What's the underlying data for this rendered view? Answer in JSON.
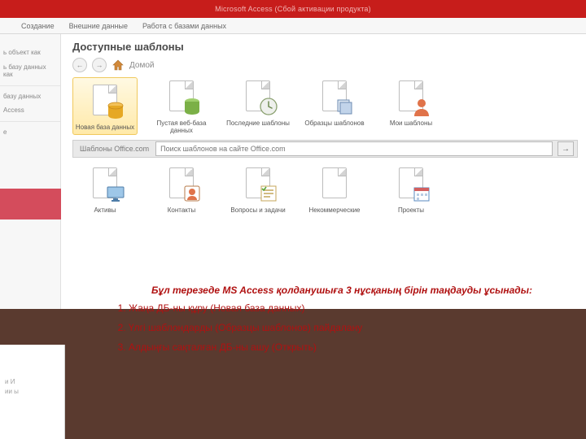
{
  "titlebar": "Microsoft Access (Сбой активации продукта)",
  "ribbon_tabs": [
    "",
    "Создание",
    "Внешние данные",
    "Работа с базами данных"
  ],
  "left_panel": {
    "items_top": [
      "",
      "ь объект как",
      "ь базу данных как"
    ],
    "items_mid": [
      "базу данных",
      "Access"
    ],
    "е": "е",
    "footer": [
      "и И",
      "ии\nы"
    ]
  },
  "main": {
    "section_title": "Доступные шаблоны",
    "crumb": "Домой",
    "templates_row1": [
      {
        "label": "Новая база данных",
        "icon": "db-yellow",
        "selected": true
      },
      {
        "label": "Пустая веб-база данных",
        "icon": "db-green"
      },
      {
        "label": "Последние шаблоны",
        "icon": "clock"
      },
      {
        "label": "Образцы шаблонов",
        "icon": "stack"
      },
      {
        "label": "Мои шаблоны",
        "icon": "person"
      }
    ],
    "office_band_label": "Шаблоны Office.com",
    "search_placeholder": "Поиск шаблонов на сайте Office.com",
    "templates_row2": [
      {
        "label": "Активы",
        "icon": "monitor"
      },
      {
        "label": "Контакты",
        "icon": "contact"
      },
      {
        "label": "Вопросы и задачи",
        "icon": "checklist"
      },
      {
        "label": "Некоммерческие",
        "icon": "blank"
      },
      {
        "label": "Проекты",
        "icon": "calendar"
      }
    ]
  },
  "lecture": {
    "intro": "Бұл терезеде MS Access қолданушыға 3 нұсқаның бірін таңдауды ұсынады:",
    "items": [
      "Жаңа ДБ-ны құру (Новая база данных)",
      "Үлгі шаблондарды (Образцы шаблонов) пайдалану",
      "Алдыңғы сақталған ДБ-ны ашу (Открыть)"
    ]
  }
}
